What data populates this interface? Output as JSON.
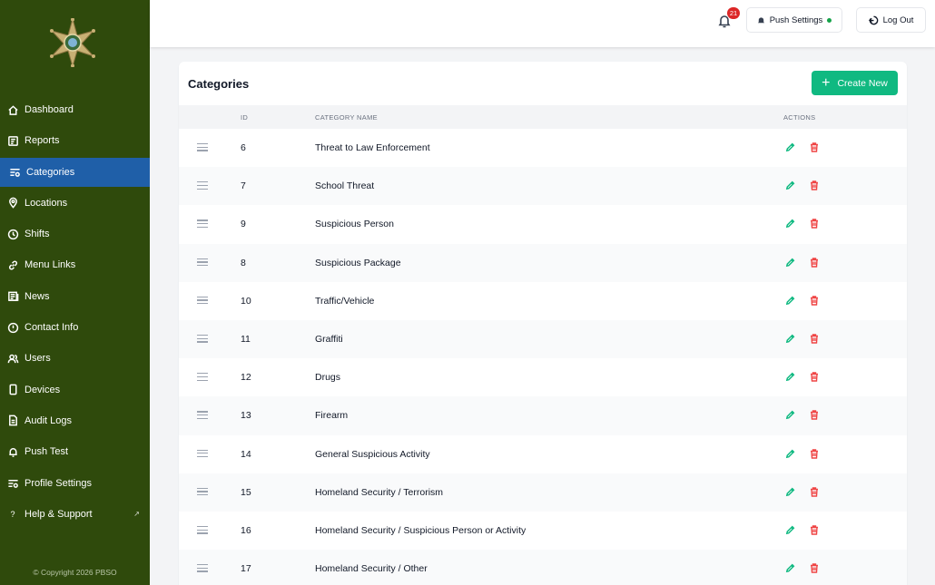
{
  "sidebar": {
    "items": [
      {
        "label": "Dashboard",
        "icon": "home-icon"
      },
      {
        "label": "Reports",
        "icon": "reports-icon"
      },
      {
        "label": "Categories",
        "icon": "categories-icon",
        "active": true
      },
      {
        "label": "Locations",
        "icon": "location-pin-icon"
      },
      {
        "label": "Shifts",
        "icon": "clock-icon"
      },
      {
        "label": "Menu Links",
        "icon": "link-icon"
      },
      {
        "label": "News",
        "icon": "news-icon"
      },
      {
        "label": "Contact Info",
        "icon": "info-icon"
      },
      {
        "label": "Users",
        "icon": "users-icon"
      },
      {
        "label": "Devices",
        "icon": "device-icon"
      },
      {
        "label": "Audit Logs",
        "icon": "document-icon"
      },
      {
        "label": "Push Test",
        "icon": "bell-icon"
      },
      {
        "label": "Profile Settings",
        "icon": "settings-icon"
      },
      {
        "label": "Help & Support",
        "icon": "question-icon"
      }
    ],
    "copyright": "© Copyright 2026 PBSO"
  },
  "header": {
    "notification_count": "21",
    "push_settings_label": "Push Settings",
    "logout_label": "Log Out"
  },
  "colors": {
    "sidebar_bg": "#2f4a0c",
    "active_item": "#1f5fa8",
    "accent": "#10b981",
    "danger": "#ef4444"
  },
  "main": {
    "title": "Categories",
    "create_label": "Create New",
    "columns": {
      "id": "ID",
      "name": "CATEGORY NAME",
      "actions": "ACTIONS"
    },
    "rows": [
      {
        "id": "6",
        "name": "Threat to Law Enforcement"
      },
      {
        "id": "7",
        "name": "School Threat"
      },
      {
        "id": "9",
        "name": "Suspicious Person"
      },
      {
        "id": "8",
        "name": "Suspicious Package"
      },
      {
        "id": "10",
        "name": "Traffic/Vehicle"
      },
      {
        "id": "11",
        "name": "Graffiti"
      },
      {
        "id": "12",
        "name": "Drugs"
      },
      {
        "id": "13",
        "name": "Firearm"
      },
      {
        "id": "14",
        "name": "General Suspicious Activity"
      },
      {
        "id": "15",
        "name": "Homeland Security / Terrorism"
      },
      {
        "id": "16",
        "name": "Homeland Security / Suspicious Person or Activity"
      },
      {
        "id": "17",
        "name": "Homeland Security / Other"
      }
    ]
  }
}
